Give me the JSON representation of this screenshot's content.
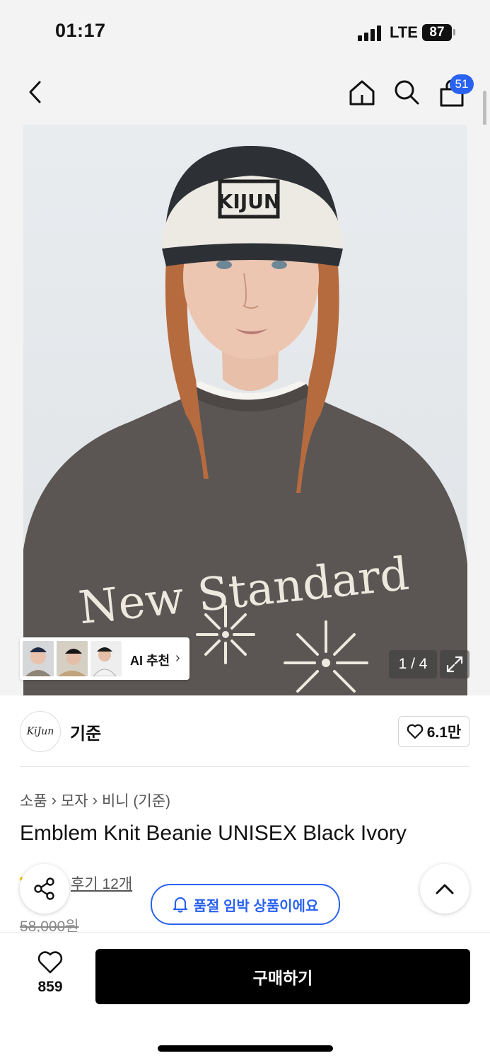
{
  "status": {
    "time": "01:17",
    "network": "LTE",
    "battery": "87"
  },
  "nav": {
    "back_icon": "chevron-left-icon",
    "home_icon": "home-icon",
    "search_icon": "search-icon",
    "cart_icon": "shopping-bag-icon",
    "cart_count": "51"
  },
  "gallery": {
    "print_text": "New Standard",
    "beanie_text": "KIJUN",
    "counter": "1 / 4",
    "ai_label": "AI 추천",
    "ai_chevron": "›",
    "expand_icon": "expand-icon"
  },
  "brand": {
    "logo_text": "KiJun",
    "name": "기준",
    "likes": "6.1만"
  },
  "breadcrumb": [
    "소품",
    "모자",
    "비니 (기준)"
  ],
  "product": {
    "title": "Emblem Knit Beanie UNISEX Black Ivory",
    "reviews": "후기 12개",
    "old_price": "58,000원",
    "soldout_notice": "품절 임박 상품이에요"
  },
  "bottom": {
    "wish_count": "859",
    "buy_label": "구매하기"
  },
  "colors": {
    "accent_blue": "#2a62f0",
    "buy_button": "#000000",
    "bg_gray": "#f3f3f3"
  }
}
